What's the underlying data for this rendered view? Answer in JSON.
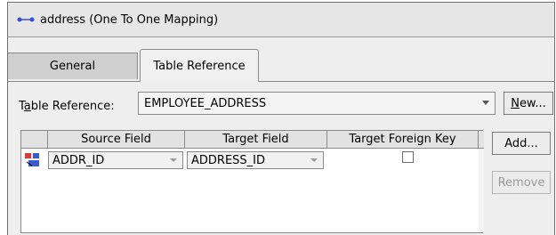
{
  "header": {
    "icon": "one-to-one-mapping-icon",
    "title": "address (One To One Mapping)"
  },
  "tabs": [
    {
      "label": "General",
      "active": false
    },
    {
      "label": "Table Reference",
      "active": true
    }
  ],
  "table_reference": {
    "label_prefix": "T",
    "label_mnemonic": "a",
    "label_suffix": "ble Reference:",
    "selected_value": "EMPLOYEE_ADDRESS",
    "new_button": {
      "mnemonic": "N",
      "rest": "ew..."
    }
  },
  "grid": {
    "columns": [
      "Source Field",
      "Target Field",
      "Target Foreign Key"
    ],
    "rows": [
      {
        "icon": "field-reference-icon",
        "source": "ADDR_ID",
        "target": "ADDRESS_ID",
        "target_foreign_key": false
      }
    ]
  },
  "side_buttons": {
    "add_label": "Add...",
    "remove_label": "Remove"
  }
}
